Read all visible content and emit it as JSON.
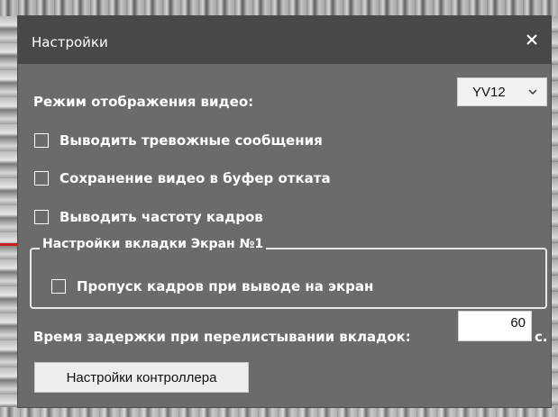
{
  "dialog": {
    "title": "Настройки",
    "close_icon": "close-icon"
  },
  "video_mode": {
    "label": "Режим отображения видео:",
    "selected": "YV12"
  },
  "options": [
    {
      "label": "Выводить тревожные сообщения",
      "checked": false
    },
    {
      "label": "Сохранение видео в буфер отката",
      "checked": false
    },
    {
      "label": "Выводить частоту кадров",
      "checked": false
    }
  ],
  "screen_group": {
    "legend": "Настройки вкладки Экран №1",
    "skip_frames_label": "Пропуск кадров при выводе на экран",
    "skip_frames_checked": false
  },
  "delay": {
    "label": "Время задержки при перелистывании вкладок:",
    "value": "60",
    "unit": "с."
  },
  "controller_button": {
    "label": "Настройки контроллера"
  },
  "colors": {
    "dialog_bg": "#6b6b6b",
    "titlebar_bg": "#484848",
    "text": "#ffffff"
  }
}
